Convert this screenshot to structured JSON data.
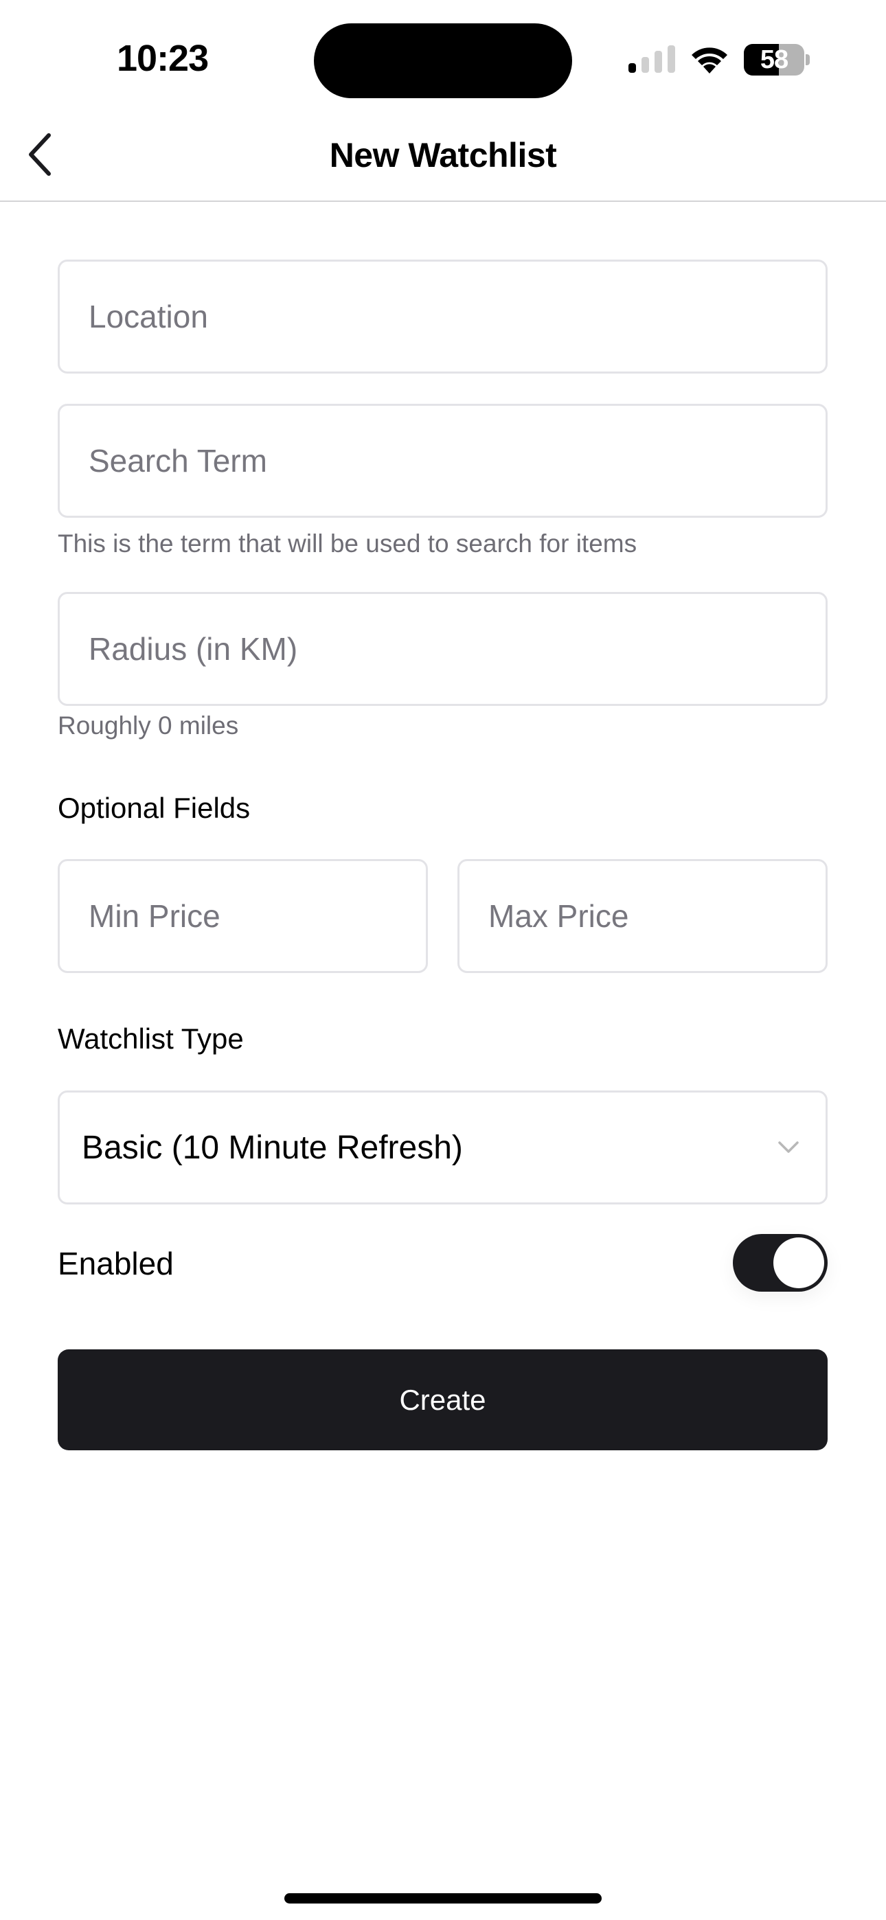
{
  "status_bar": {
    "time": "10:23",
    "signal_bars_total": 4,
    "signal_bars_active": 1,
    "battery_percent": 58,
    "battery_label": "58"
  },
  "nav": {
    "title": "New Watchlist",
    "back_icon": "chevron-left-icon"
  },
  "form": {
    "location": {
      "placeholder": "Location",
      "value": ""
    },
    "search_term": {
      "placeholder": "Search Term",
      "value": "",
      "helper": "This is the term that will be used to search for items"
    },
    "radius": {
      "placeholder": "Radius (in KM)",
      "value": "",
      "helper": "Roughly 0 miles"
    },
    "optional_label": "Optional Fields",
    "min_price": {
      "placeholder": "Min Price",
      "value": ""
    },
    "max_price": {
      "placeholder": "Max Price",
      "value": ""
    },
    "watchlist_type": {
      "label": "Watchlist Type",
      "selected": "Basic (10 Minute Refresh)",
      "icon": "chevron-down-icon"
    },
    "enabled": {
      "label": "Enabled",
      "on": true
    },
    "submit_label": "Create"
  },
  "colors": {
    "primary": "#1b1b1f",
    "field_border": "#e3e3e7",
    "placeholder": "#77767e",
    "helper_text": "#6e6d75",
    "chevron": "#b8b8b8"
  }
}
